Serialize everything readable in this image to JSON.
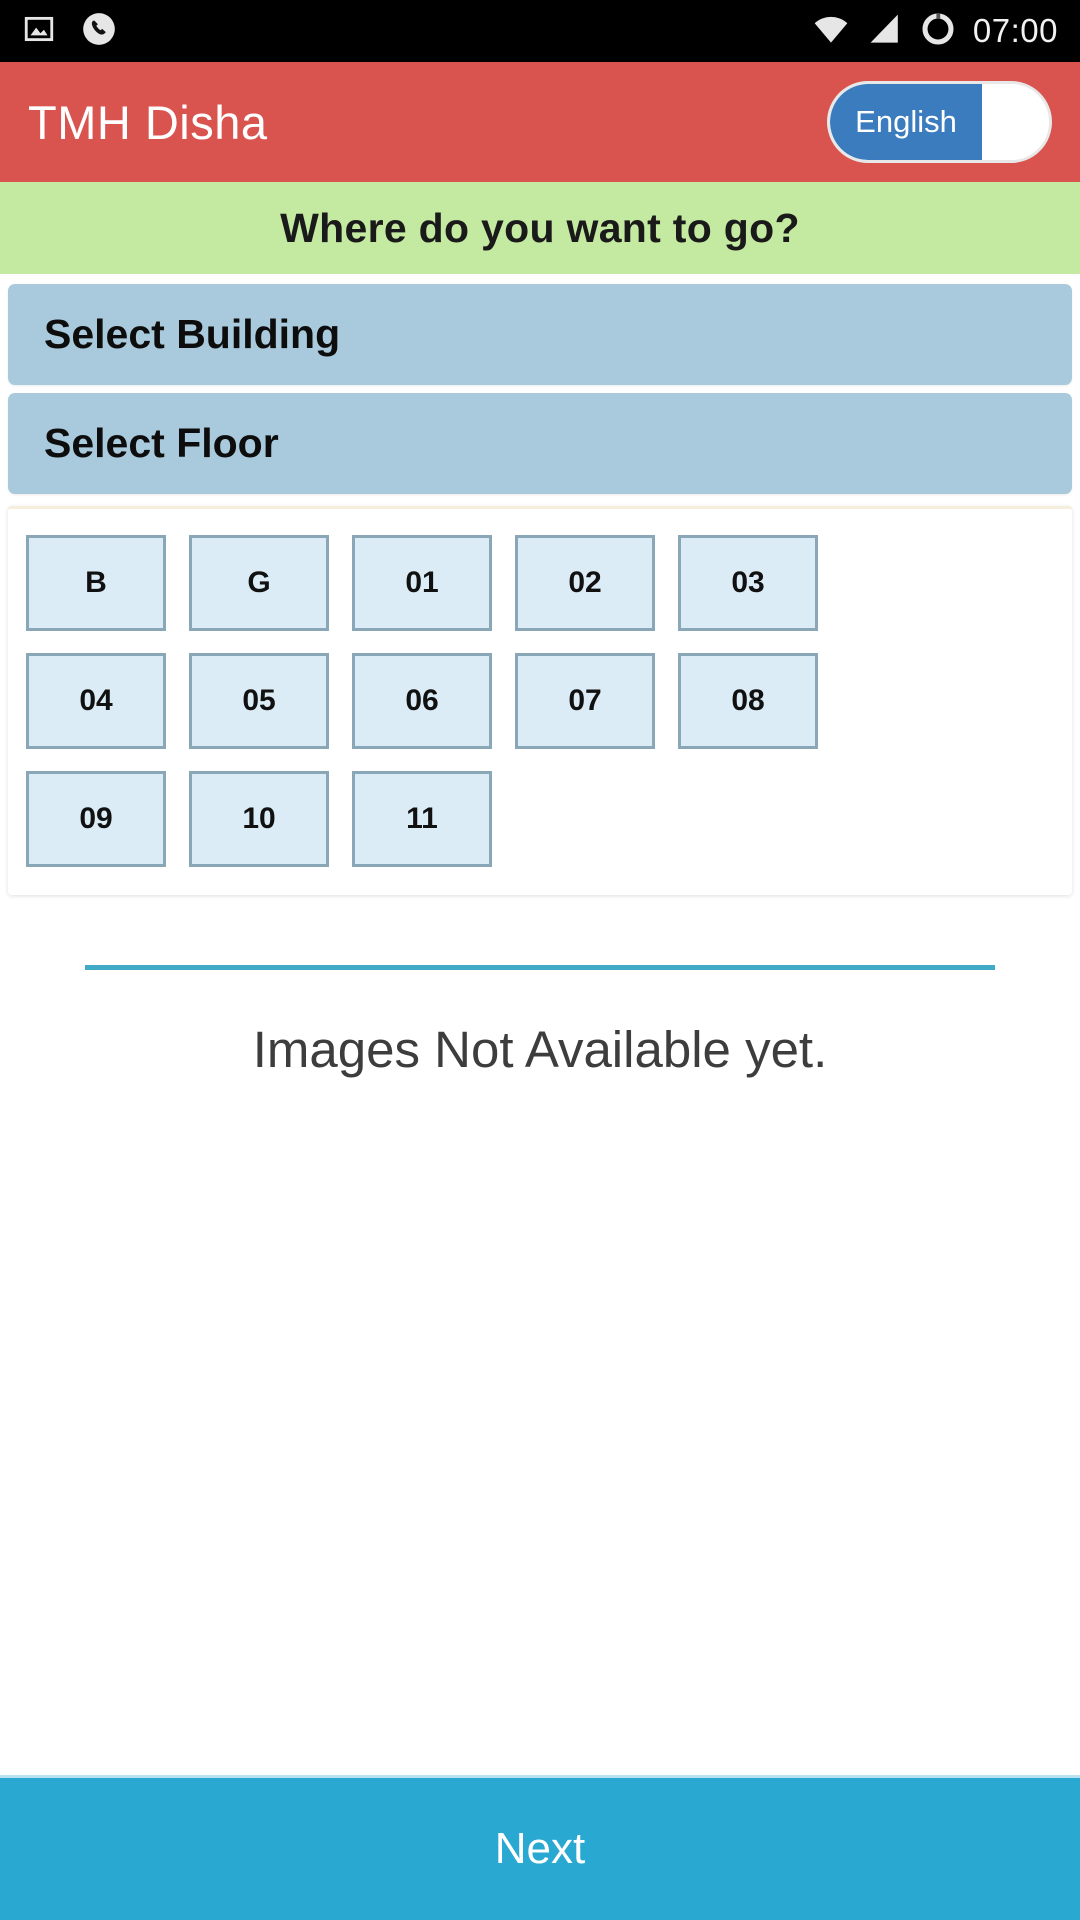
{
  "status_bar": {
    "icons_left": [
      "image-icon",
      "phone-icon"
    ],
    "icons_right": [
      "wifi-icon",
      "signal-icon",
      "battery-icon"
    ],
    "time": "07:00"
  },
  "app_bar": {
    "title": "TMH Disha",
    "language_toggle": {
      "label": "English",
      "state": "on",
      "active_color": "#3a7cbd"
    },
    "background_color": "#d9534f"
  },
  "question_band": {
    "text": "Where do you want to go?",
    "background_color": "#c4e9a0"
  },
  "selectors": [
    {
      "label": "Select Building",
      "name": "select-building"
    },
    {
      "label": "Select Floor",
      "name": "select-floor"
    }
  ],
  "floor_grid": {
    "rows": [
      [
        "B",
        "G",
        "01",
        "02",
        "03"
      ],
      [
        "04",
        "05",
        "06",
        "07",
        "08"
      ],
      [
        "09",
        "10",
        "11"
      ]
    ],
    "tile_background": "#dcecf6",
    "tile_border": "#8aa7b7"
  },
  "divider": {
    "color": "#41abc7"
  },
  "message": {
    "text": "Images Not Available yet."
  },
  "footer": {
    "next_label": "Next",
    "background_color": "#29a8d2"
  }
}
